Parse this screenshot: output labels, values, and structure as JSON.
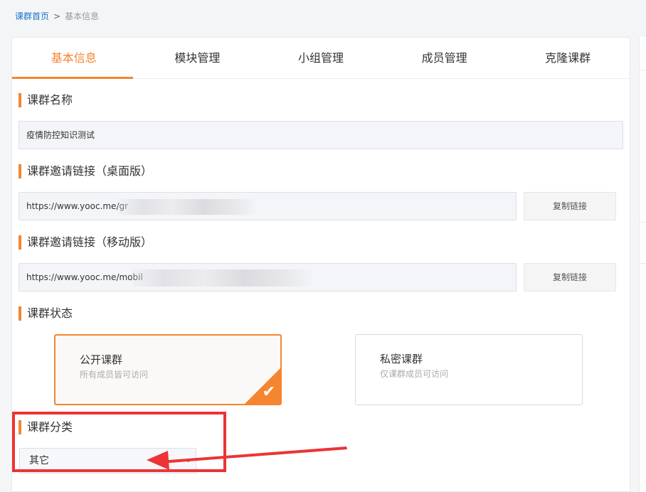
{
  "breadcrumb": {
    "home": "课群首页",
    "separator": ">",
    "current": "基本信息"
  },
  "tabs": [
    {
      "label": "基本信息",
      "active": true
    },
    {
      "label": "模块管理",
      "active": false
    },
    {
      "label": "小组管理",
      "active": false
    },
    {
      "label": "成员管理",
      "active": false
    },
    {
      "label": "克隆课群",
      "active": false
    }
  ],
  "sections": {
    "name_title": "课群名称",
    "name_value": "疫情防控知识测试",
    "desktop_title": "课群邀请链接（桌面版）",
    "desktop_link": "https://www.yooc.me/gr",
    "mobile_title": "课群邀请链接（移动版）",
    "mobile_link": "https://www.yooc.me/mobil",
    "copy_label": "复制链接",
    "status_title": "课群状态",
    "category_title": "课群分类"
  },
  "status_options": [
    {
      "title": "公开课群",
      "desc": "所有成员皆可访问",
      "selected": true
    },
    {
      "title": "私密课群",
      "desc": "仅课群成员可访问",
      "selected": false
    }
  ],
  "category": {
    "value": "其它"
  },
  "icons": {
    "check": "check-icon",
    "caret": "chevron-down-icon"
  },
  "colors": {
    "accent": "#f5852f",
    "annotation": "#ec3434",
    "link": "#1a73c9"
  }
}
